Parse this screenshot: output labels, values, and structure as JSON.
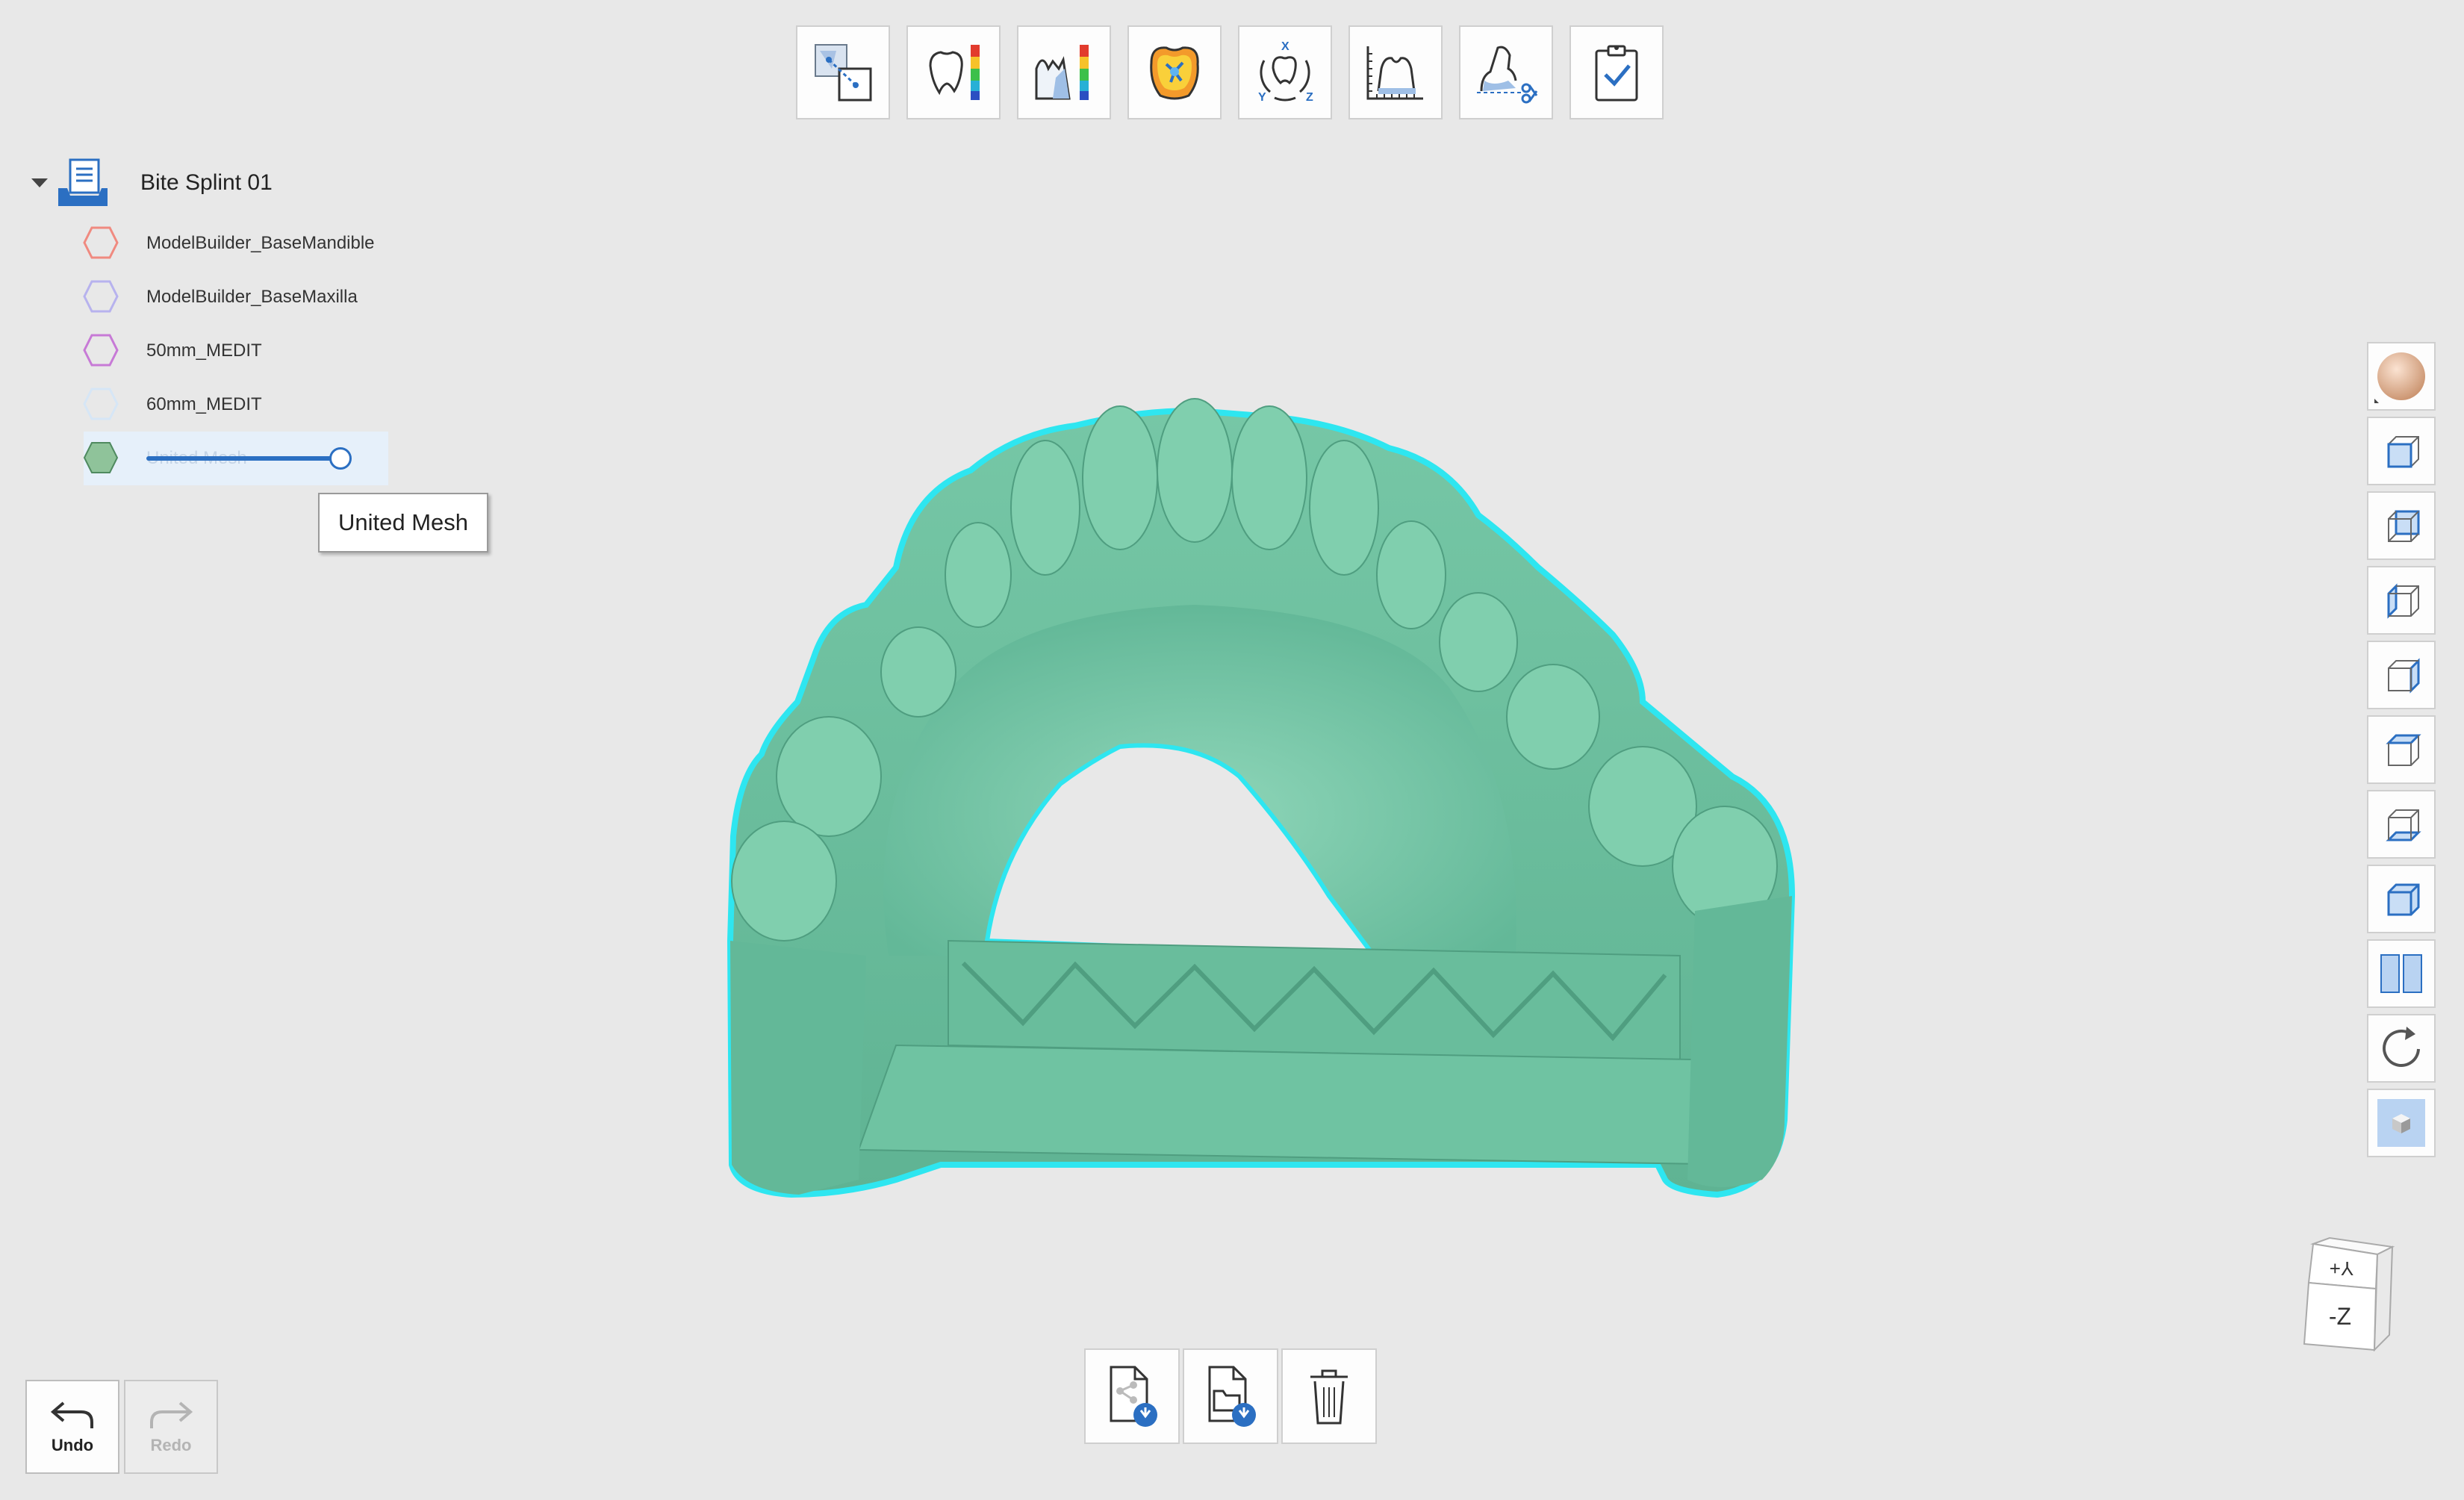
{
  "tree": {
    "project": {
      "label": "Bite Splint 01",
      "icon": "document-tray-icon",
      "expanded": true
    },
    "items": [
      {
        "label": "ModelBuilder_BaseMandible",
        "color": "#f08a80",
        "icon": "hexagon-outline-icon"
      },
      {
        "label": "ModelBuilder_BaseMaxilla",
        "color": "#b7b2ee",
        "icon": "hexagon-outline-icon"
      },
      {
        "label": "50mm_MEDIT",
        "color": "#c77ad6",
        "icon": "hexagon-outline-icon"
      },
      {
        "label": "60mm_MEDIT",
        "color": "#d6e6f6",
        "icon": "hexagon-outline-icon"
      },
      {
        "label": "United Mesh",
        "color": "#8fc39a",
        "icon": "hexagon-filled-icon",
        "selected": true,
        "opacity_value": 1.0
      }
    ]
  },
  "tooltip": {
    "text": "United Mesh"
  },
  "top_toolbar": [
    {
      "name": "align-tool",
      "icon": "align-icon"
    },
    {
      "name": "deviation-display",
      "icon": "tooth-deviation-icon"
    },
    {
      "name": "thickness-analysis",
      "icon": "thickness-map-icon"
    },
    {
      "name": "occlusion-analysis",
      "icon": "occlusion-icon"
    },
    {
      "name": "axis-setting",
      "icon": "xyz-axis-icon"
    },
    {
      "name": "measurement",
      "icon": "measure-ruler-icon"
    },
    {
      "name": "cut-tool",
      "icon": "scissors-cut-icon"
    },
    {
      "name": "complete",
      "icon": "checklist-icon"
    }
  ],
  "side_toolbar": [
    {
      "name": "material-ball",
      "icon": "material-sphere-icon"
    },
    {
      "name": "view-front",
      "icon": "cube-front-icon"
    },
    {
      "name": "view-back",
      "icon": "cube-back-icon"
    },
    {
      "name": "view-left",
      "icon": "cube-left-icon"
    },
    {
      "name": "view-right",
      "icon": "cube-right-icon"
    },
    {
      "name": "view-top",
      "icon": "cube-top-icon"
    },
    {
      "name": "view-bottom",
      "icon": "cube-bottom-icon"
    },
    {
      "name": "view-iso",
      "icon": "cube-iso-icon"
    },
    {
      "name": "split-view",
      "icon": "split-view-icon"
    },
    {
      "name": "reset-view",
      "icon": "refresh-icon"
    },
    {
      "name": "render-mode",
      "icon": "solid-cube-icon"
    }
  ],
  "bottom_toolbar": [
    {
      "name": "export-share",
      "icon": "file-share-icon"
    },
    {
      "name": "import-file",
      "icon": "folder-import-icon"
    },
    {
      "name": "delete",
      "icon": "trash-icon"
    }
  ],
  "history": {
    "undo_label": "Undo",
    "redo_label": "Redo",
    "redo_enabled": false
  },
  "orientation_cube": {
    "front_label": "-Z",
    "top_label": "Y+"
  },
  "colors": {
    "model": "#6dbf9e",
    "outline": "#2ee6f0",
    "accent": "#2b6fc2"
  }
}
